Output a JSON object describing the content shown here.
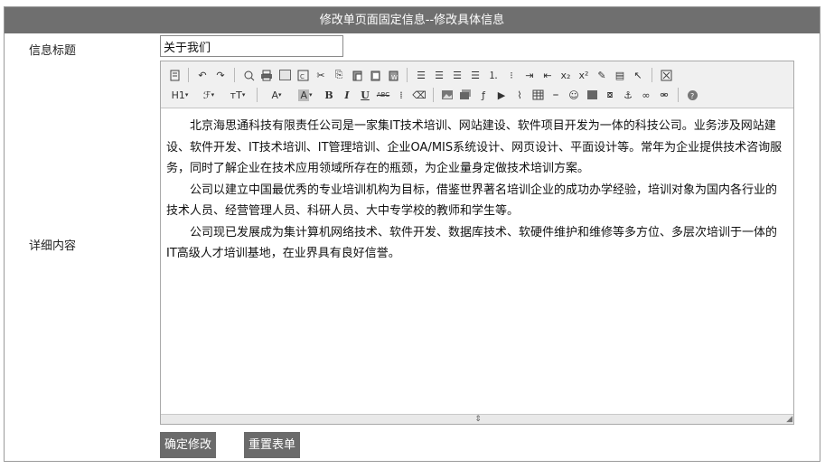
{
  "header": {
    "title": "修改单页面固定信息--修改具体信息"
  },
  "form": {
    "title_label": "信息标题",
    "title_value": "关于我们",
    "content_label": "详细内容"
  },
  "toolbar": {
    "row1": [
      "source-icon",
      "undo-icon",
      "redo-icon",
      "preview-icon",
      "print-icon",
      "template-icon",
      "paste-code-icon",
      "cut-icon",
      "copy-icon",
      "paste-icon",
      "paste-text-icon",
      "paste-word-icon",
      "align-left-icon",
      "align-center-icon",
      "align-right-icon",
      "justify-icon",
      "ordered-list-icon",
      "unordered-list-icon",
      "indent-icon",
      "outdent-icon",
      "subscript-icon",
      "superscript-icon",
      "clear-format-icon",
      "select-all-icon",
      "pointer-icon",
      "fullscreen-icon"
    ],
    "heading_label": "H1",
    "font_family_label": "ℱ",
    "font_size_label": "тT",
    "font_color_label": "A",
    "highlight_label": "A",
    "bold_label": "B",
    "italic_label": "I",
    "underline_label": "U",
    "strike_label": "ABC",
    "row2_icons": [
      "line-height-icon",
      "eraser-icon",
      "image-icon",
      "multi-image-icon",
      "flash-icon",
      "media-icon",
      "attachment-icon",
      "table-icon",
      "hr-icon",
      "emoticon-icon",
      "map-icon",
      "pagebreak-icon",
      "anchor-icon",
      "link-icon",
      "unlink-icon",
      "help-icon"
    ]
  },
  "content": {
    "paragraphs": [
      "北京海思通科技有限责任公司是一家集IT技术培训、网站建设、软件项目开发为一体的科技公司。业务涉及网站建设、软件开发、IT技术培训、IT管理培训、企业OA/MIS系统设计、网页设计、平面设计等。常年为企业提供技术咨询服务，同时了解企业在技术应用领域所存在的瓶颈，为企业量身定做技术培训方案。",
      "公司以建立中国最优秀的专业培训机构为目标，借鉴世界著名培训企业的成功办学经验，培训对象为国内各行业的技术人员、经营管理人员、科研人员、大中专学校的教师和学生等。",
      "公司现已发展成为集计算机网络技术、软件开发、数据库技术、软硬件维护和维修等多方位、多层次培训于一体的IT高级人才培训基地，在业界具有良好信誉。"
    ]
  },
  "buttons": {
    "submit_label": "确定修改",
    "reset_label": "重置表单"
  }
}
